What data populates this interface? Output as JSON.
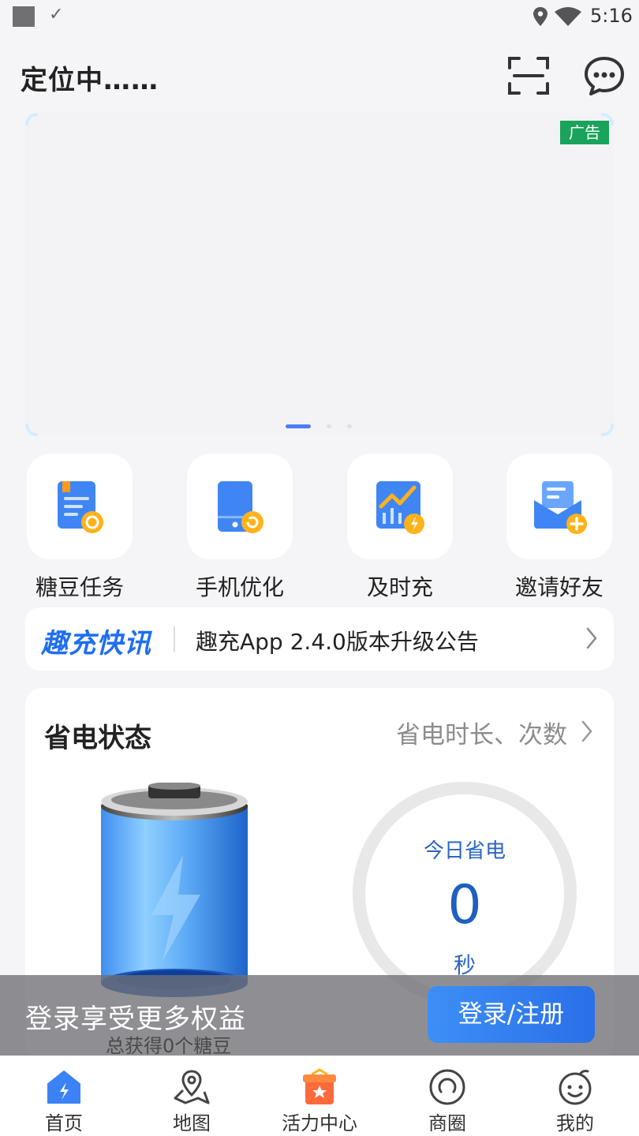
{
  "status_bar": {
    "time": "5:16"
  },
  "header": {
    "location": "定位中……"
  },
  "banner": {
    "ad_label": "广告",
    "page_count": 3,
    "active_page": 1
  },
  "quick_actions": [
    {
      "label": "糖豆任务",
      "icon": "task-doc-icon"
    },
    {
      "label": "手机优化",
      "icon": "phone-optimize-icon"
    },
    {
      "label": "及时充",
      "icon": "charge-chart-icon"
    },
    {
      "label": "邀请好友",
      "icon": "invite-mail-icon"
    }
  ],
  "news": {
    "logo": "趣充快讯",
    "text": "趣充App 2.4.0版本升级公告"
  },
  "power": {
    "title": "省电状态",
    "link": "省电时长、次数",
    "today_label": "今日省电",
    "today_value": "0",
    "today_unit": "秒"
  },
  "login": {
    "prompt": "登录享受更多权益",
    "subtitle": "总获得0个糖豆",
    "button": "登录/注册"
  },
  "tabs": [
    {
      "label": "首页",
      "icon": "home-icon",
      "active": true
    },
    {
      "label": "地图",
      "icon": "map-icon",
      "active": false
    },
    {
      "label": "活力中心",
      "icon": "gift-box-icon",
      "active": false
    },
    {
      "label": "商圈",
      "icon": "circle-icon",
      "active": false
    },
    {
      "label": "我的",
      "icon": "face-icon",
      "active": false
    }
  ],
  "colors": {
    "accent": "#2a6fe8",
    "ad_green": "#1aa35a",
    "value_blue": "#1f5fbf"
  }
}
